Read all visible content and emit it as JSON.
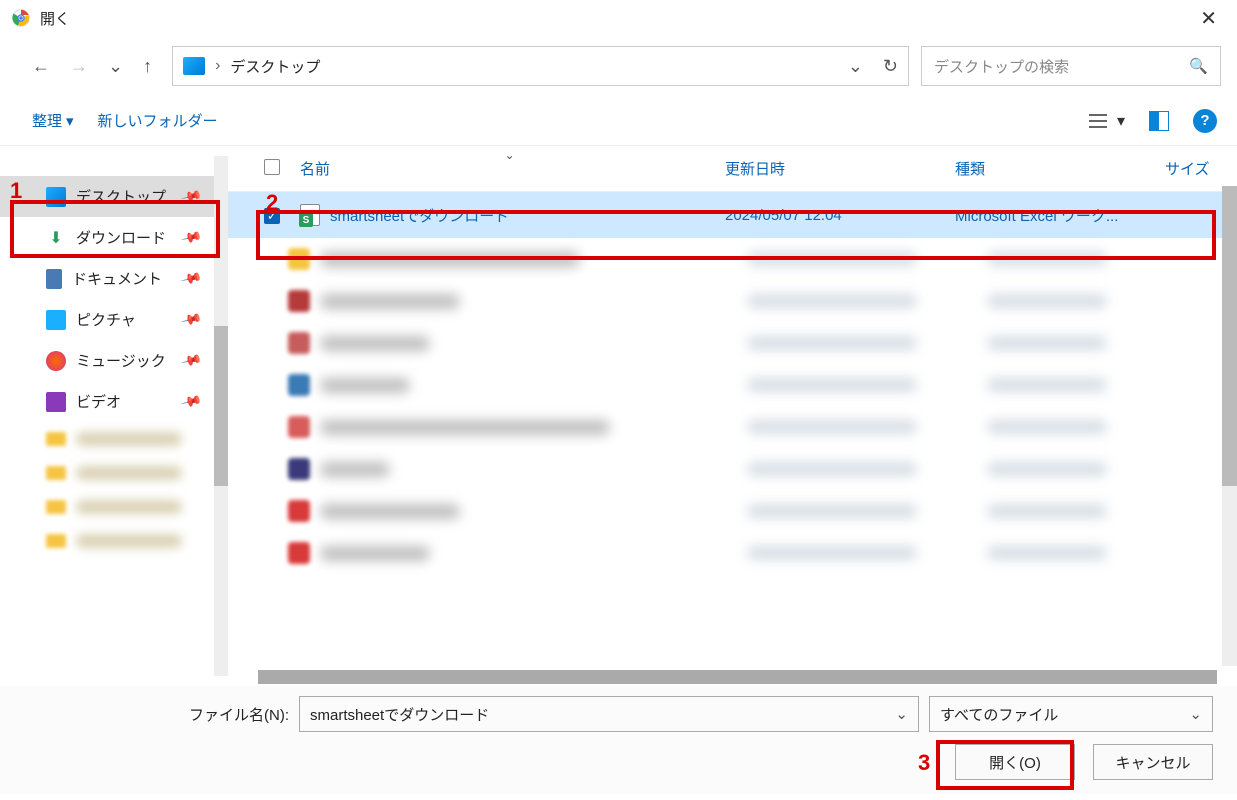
{
  "title": "開く",
  "breadcrumb": {
    "location": "デスクトップ"
  },
  "search": {
    "placeholder": "デスクトップの検索"
  },
  "toolbar": {
    "organize": "整理",
    "new_folder": "新しいフォルダー"
  },
  "sidebar": {
    "items": [
      {
        "label": "デスクトップ",
        "icon": "desktop",
        "selected": true
      },
      {
        "label": "ダウンロード",
        "icon": "download"
      },
      {
        "label": "ドキュメント",
        "icon": "document"
      },
      {
        "label": "ピクチャ",
        "icon": "picture"
      },
      {
        "label": "ミュージック",
        "icon": "music"
      },
      {
        "label": "ビデオ",
        "icon": "video"
      }
    ]
  },
  "columns": {
    "name": "名前",
    "date": "更新日時",
    "type": "種類",
    "size": "サイズ"
  },
  "file": {
    "name": "smartsheetでダウンロード",
    "date": "2024/05/07 12:04",
    "type": "Microsoft Excel ワーク..."
  },
  "bottom": {
    "filename_label": "ファイル名(N):",
    "filename_value": "smartsheetでダウンロード",
    "filter": "すべてのファイル",
    "open": "開く(O)",
    "cancel": "キャンセル"
  },
  "markers": {
    "m1": "1",
    "m2": "2",
    "m3": "3"
  }
}
